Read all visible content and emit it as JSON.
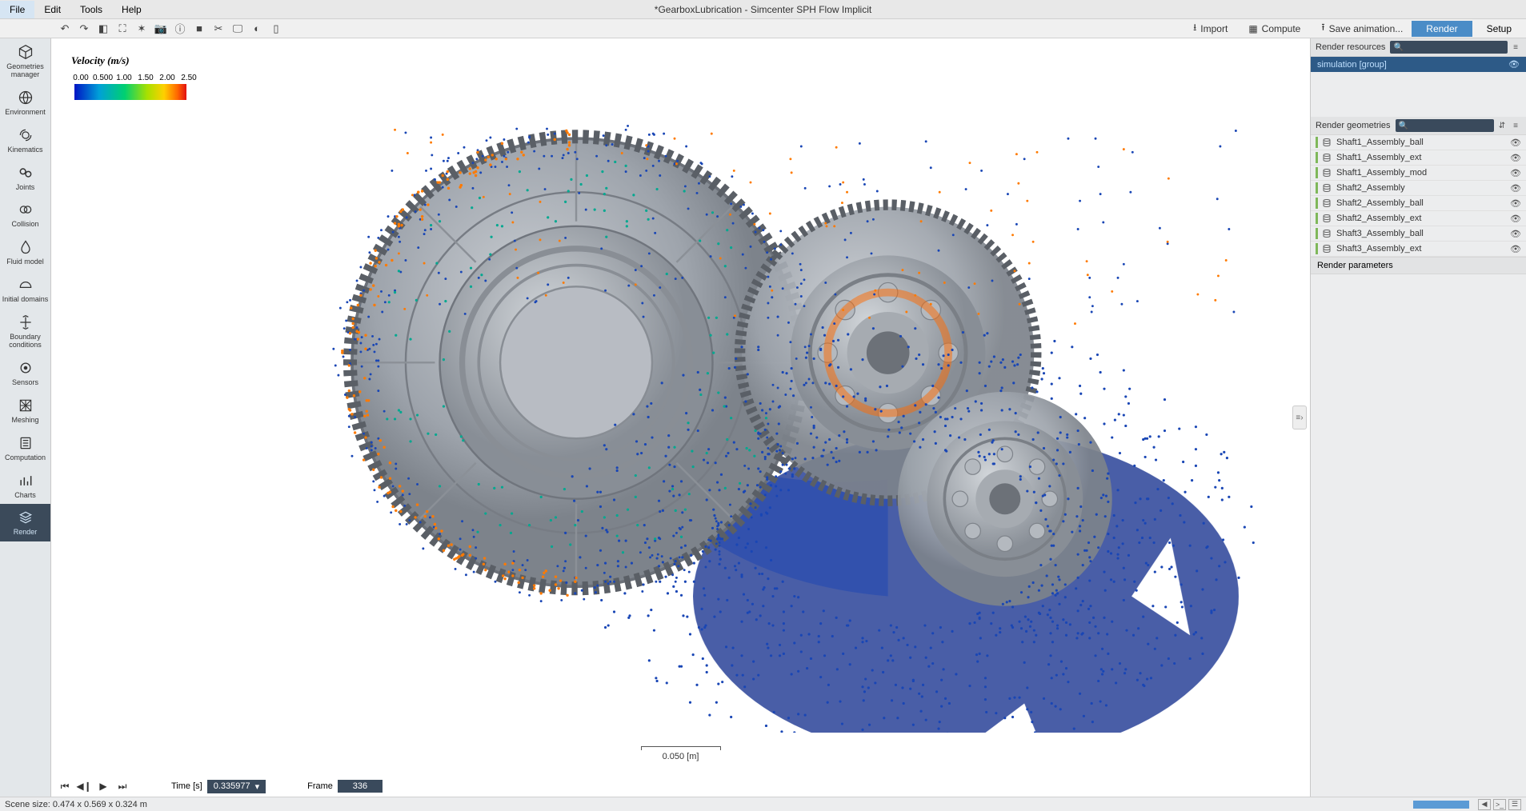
{
  "window": {
    "title": "*GearboxLubrication - Simcenter SPH Flow Implicit"
  },
  "menu": {
    "file": "File",
    "edit": "Edit",
    "tools": "Tools",
    "help": "Help"
  },
  "toolbar_right": {
    "import": "Import",
    "compute": "Compute",
    "save_anim": "Save animation...",
    "tab_render": "Render",
    "tab_setup": "Setup"
  },
  "sidebar": {
    "items": [
      {
        "label": "Geometries manager",
        "icon": "cube"
      },
      {
        "label": "Environment",
        "icon": "globe"
      },
      {
        "label": "Kinematics",
        "icon": "motion"
      },
      {
        "label": "Joints",
        "icon": "chain"
      },
      {
        "label": "Collision",
        "icon": "collide"
      },
      {
        "label": "Fluid model",
        "icon": "drop"
      },
      {
        "label": "Initial domains",
        "icon": "dome"
      },
      {
        "label": "Boundary conditions",
        "icon": "arrows"
      },
      {
        "label": "Sensors",
        "icon": "target"
      },
      {
        "label": "Meshing",
        "icon": "mesh"
      },
      {
        "label": "Computation",
        "icon": "calc"
      },
      {
        "label": "Charts",
        "icon": "chart"
      },
      {
        "label": "Render",
        "icon": "layers"
      }
    ]
  },
  "legend": {
    "title": "Velocity (m/s)",
    "ticks": [
      "0.00",
      "0.500",
      "1.00",
      "1.50",
      "2.00",
      "2.50"
    ]
  },
  "scale": {
    "label": "0.050 [m]"
  },
  "timeline": {
    "time_label": "Time [s]",
    "time_value": "0.335977",
    "frame_label": "Frame",
    "frame_value": "336"
  },
  "right_panel": {
    "resources_header": "Render resources",
    "resource_row": "simulation  [group]",
    "geometries_header": "Render geometries",
    "geometries": [
      "Shaft1_Assembly_ball",
      "Shaft1_Assembly_ext",
      "Shaft1_Assembly_mod",
      "Shaft2_Assembly",
      "Shaft2_Assembly_ball",
      "Shaft2_Assembly_ext",
      "Shaft3_Assembly_ball",
      "Shaft3_Assembly_ext"
    ],
    "params_header": "Render parameters"
  },
  "status": {
    "scene_size": "Scene size: 0.474 x 0.569 x 0.324 m"
  }
}
